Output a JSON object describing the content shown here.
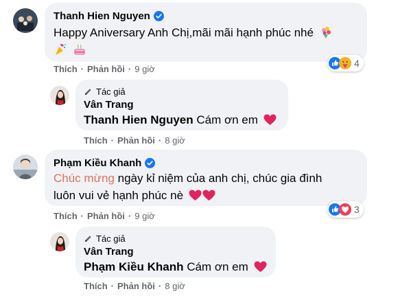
{
  "comments": [
    {
      "author": "Thanh Hien Nguyen",
      "text_line1": "Happy Aniversary Anh Chị,mãi mãi hạnh phúc nhé",
      "emojis_inline": [
        "bouquet-emoji"
      ],
      "emojis_line2": [
        "party-popper-emoji",
        "cake-emoji"
      ],
      "actions": {
        "like": "Thích",
        "reply": "Phản hồi",
        "time": "9 giờ"
      },
      "reactions": {
        "icons": [
          "like-reaction",
          "care-reaction"
        ],
        "count": "4"
      },
      "reply": {
        "badge": "Tác giả",
        "author": "Vân Trang",
        "mention": "Thanh Hien Nguyen",
        "text": "Cám ơn em",
        "actions": {
          "like": "Thích",
          "reply": "Phản hồi",
          "time": "8 giờ"
        }
      }
    },
    {
      "author": "Phạm Kiều Khanh",
      "highlight": "Chúc mừng",
      "text_line1": "ngày kỉ niệm của anh chị, chúc gia đình",
      "text_line2": "luôn vui vẻ hạnh phúc nè",
      "actions": {
        "like": "Thích",
        "reply": "Phản hồi",
        "time": "9 giờ"
      },
      "reactions": {
        "icons": [
          "like-reaction",
          "love-reaction"
        ],
        "count": "3"
      },
      "reply": {
        "badge": "Tác giả",
        "author": "Vân Trang",
        "mention": "Phạm Kiều Khanh",
        "text": "Cám ơn em",
        "actions": {
          "like": "Thích",
          "reply": "Phản hồi",
          "time": "8 giờ"
        }
      }
    }
  ],
  "colors": {
    "bubble": "#f0f2f5",
    "meta": "#65676b",
    "verified": "#1877f2",
    "highlight": "#e4715b",
    "heart": "#e0245e"
  }
}
